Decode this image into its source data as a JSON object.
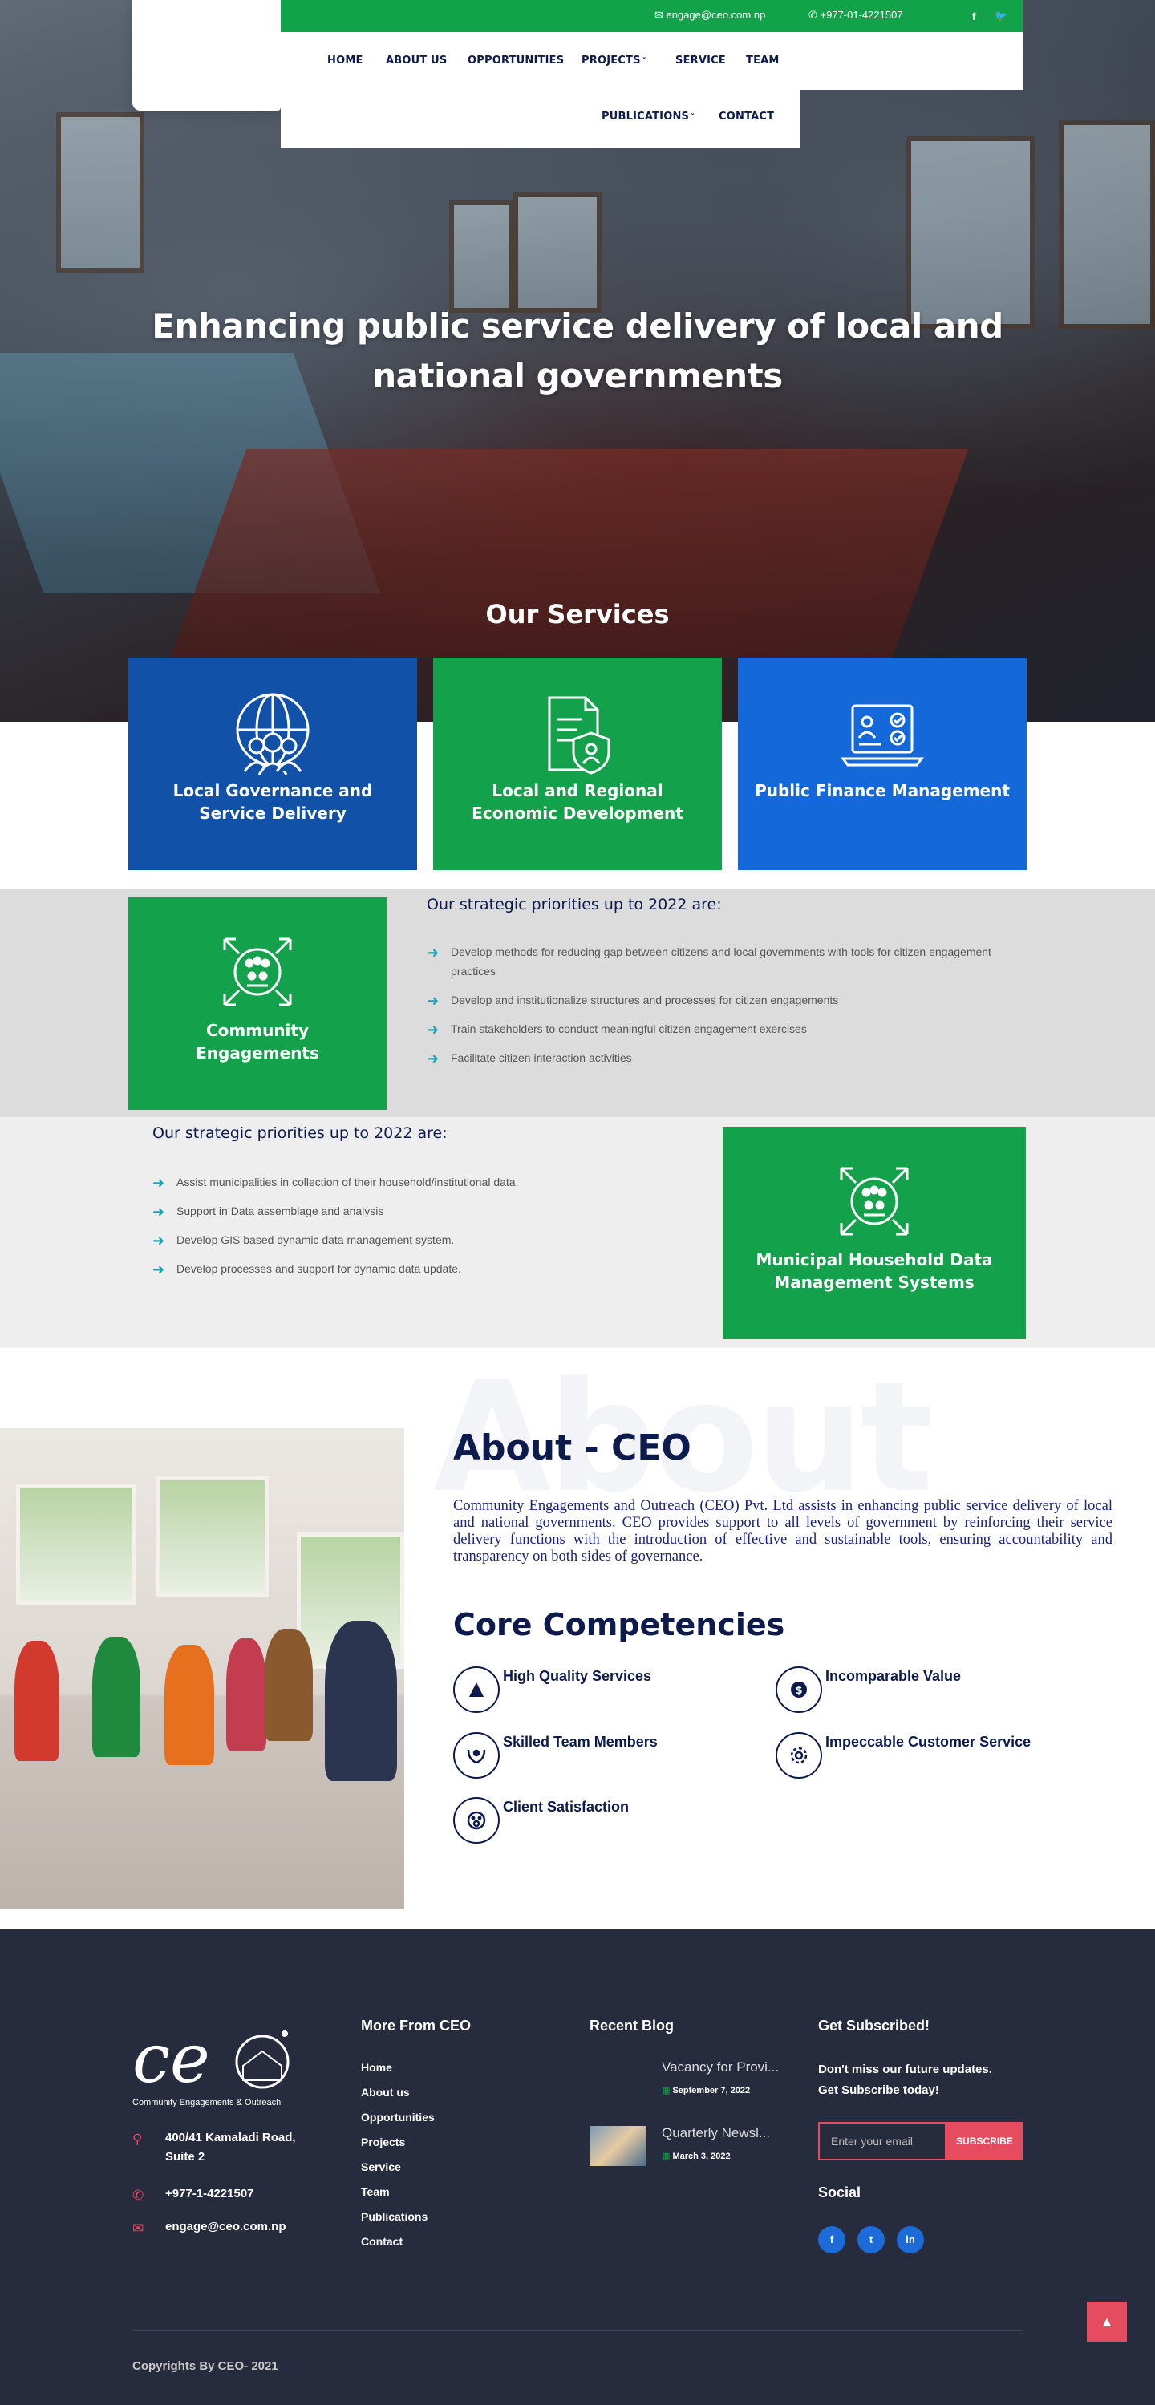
{
  "header": {
    "email": "engage@ceo.com.np",
    "phone": "+977-01-4221507",
    "social": {
      "facebook": "f",
      "twitter": "t"
    },
    "nav": [
      "HOME",
      "ABOUT US",
      "OPPORTUNITIES",
      "PROJECTS",
      "SERVICE",
      "TEAM"
    ],
    "nav2": [
      "PUBLICATIONS",
      "CONTACT"
    ]
  },
  "hero": {
    "title_line1": "Enhancing public service delivery of local and",
    "title_line2": "national governments"
  },
  "services": {
    "title": "Our Services",
    "cards": [
      {
        "label": "Local Governance and Service Delivery",
        "icon": "globe-people-icon",
        "color": "#1151a8"
      },
      {
        "label": "Local and Regional Economic Development",
        "icon": "document-shield-icon",
        "color": "#13a24b"
      },
      {
        "label": "Public Finance Management",
        "icon": "laptop-checklist-icon",
        "color": "#1468d9"
      }
    ]
  },
  "community": {
    "label": "Community Engagements",
    "heading": "Our strategic priorities up to 2022 are:",
    "items": [
      "Develop methods for reducing gap between citizens and local governments with tools for citizen engagement practices",
      "Develop and institutionalize structures and processes for citizen engagements",
      "Train stakeholders to conduct meaningful citizen engagement exercises",
      "Facilitate citizen interaction activities"
    ]
  },
  "household": {
    "label": "Municipal Household Data Management Systems",
    "heading": "Our strategic priorities up to 2022 are:",
    "items": [
      "Assist municipalities in collection of their household/institutional data.",
      "Support in Data assemblage and analysis",
      "Develop GIS based dynamic data management system.",
      "Develop processes and support for dynamic data update."
    ]
  },
  "about": {
    "bg_word": "About",
    "title": "About - CEO",
    "text": "Community Engagements and Outreach (CEO) Pvt. Ltd assists in enhancing public service delivery of local and national governments. CEO provides support to all levels of government by reinforcing their service delivery functions with the introduction of effective and sustainable tools, ensuring accountability and transparency on both sides of governance.",
    "core_title": "Core Competencies",
    "competencies": [
      "High Quality Services",
      "Incomparable Value",
      "Skilled Team Members",
      "Impeccable Customer Service",
      "Client Satisfaction"
    ]
  },
  "footer": {
    "logo_sub": "Community Engagements & Outreach",
    "address_line1": "400/41 Kamaladi Road,",
    "address_line2": "Suite 2",
    "phone": "+977-1-4221507",
    "email": "engage@ceo.com.np",
    "more_title": "More From CEO",
    "links": [
      "Home",
      "About us",
      "Opportunities",
      "Projects",
      "Service",
      "Team",
      "Publications",
      "Contact"
    ],
    "blog_title": "Recent Blog",
    "blogs": [
      {
        "title": "Vacancy for Provi...",
        "date": "September 7, 2022"
      },
      {
        "title": "Quarterly Newsl...",
        "date": "March 3, 2022"
      }
    ],
    "subscribe_title": "Get Subscribed!",
    "subscribe_text1": "Don't miss our future updates.",
    "subscribe_text2": "Get Subscribe today!",
    "subscribe_placeholder": "Enter your email",
    "subscribe_button": "SUBSCRIBE",
    "social_title": "Social",
    "social": [
      "f",
      "t",
      "in"
    ],
    "copyright": "Copyrights By CEO- 2021"
  }
}
